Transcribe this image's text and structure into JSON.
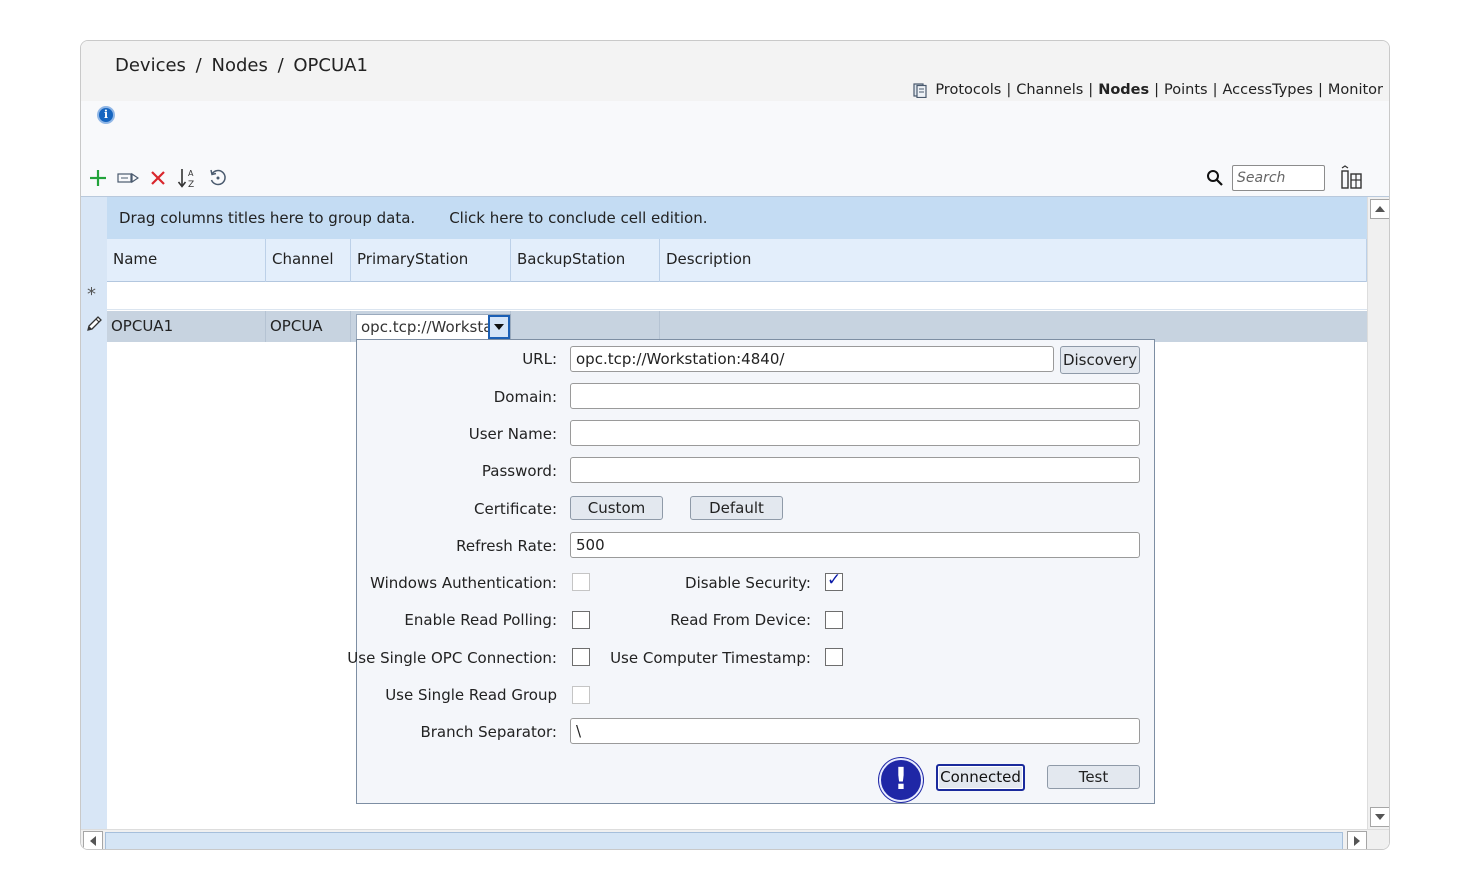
{
  "breadcrumb": {
    "items": [
      "Devices",
      "Nodes",
      "OPCUA1"
    ],
    "separator": "/"
  },
  "nav": {
    "links": [
      "Protocols",
      "Channels",
      "Nodes",
      "Points",
      "AccessTypes",
      "Monitor"
    ],
    "active": "Nodes",
    "separator": "|"
  },
  "search": {
    "placeholder": "Search"
  },
  "grid": {
    "group_hint": "Drag columns titles here to group data.",
    "conclude_hint": "Click here to conclude cell edition.",
    "columns": [
      "Name",
      "Channel",
      "PrimaryStation",
      "BackupStation",
      "Description"
    ],
    "new_row_symbol": "*",
    "rows": [
      {
        "name": "OPCUA1",
        "channel": "OPCUA",
        "primary_station": "opc.tcp://Workstation:4840/",
        "backup_station": "",
        "description": ""
      }
    ]
  },
  "popup": {
    "url_label": "URL:",
    "url_value": "opc.tcp://Workstation:4840/",
    "discovery_label": "Discovery",
    "domain_label": "Domain:",
    "domain_value": "",
    "username_label": "User Name:",
    "username_value": "",
    "password_label": "Password:",
    "password_value": "",
    "certificate_label": "Certificate:",
    "custom_label": "Custom",
    "default_label": "Default",
    "refresh_label": "Refresh Rate:",
    "refresh_value": "500",
    "win_auth_label": "Windows Authentication:",
    "win_auth_checked": false,
    "disable_security_label": "Disable Security:",
    "disable_security_checked": true,
    "read_polling_label": "Enable Read Polling:",
    "read_polling_checked": false,
    "read_device_label": "Read From Device:",
    "read_device_checked": false,
    "single_opc_label": "Use Single OPC Connection:",
    "single_opc_checked": false,
    "computer_ts_label": "Use Computer Timestamp:",
    "computer_ts_checked": false,
    "single_read_label": "Use Single Read Group",
    "single_read_checked": false,
    "branch_label": "Branch Separator:",
    "branch_value": "\\",
    "connected_label": "Connected",
    "test_label": "Test",
    "warning_symbol": "!"
  },
  "colors": {
    "accent": "#1f27a6",
    "group_panel": "#c4dcf3",
    "selected_row": "#c7d3e0",
    "add_green": "#22a33a",
    "delete_red": "#d9262c"
  }
}
